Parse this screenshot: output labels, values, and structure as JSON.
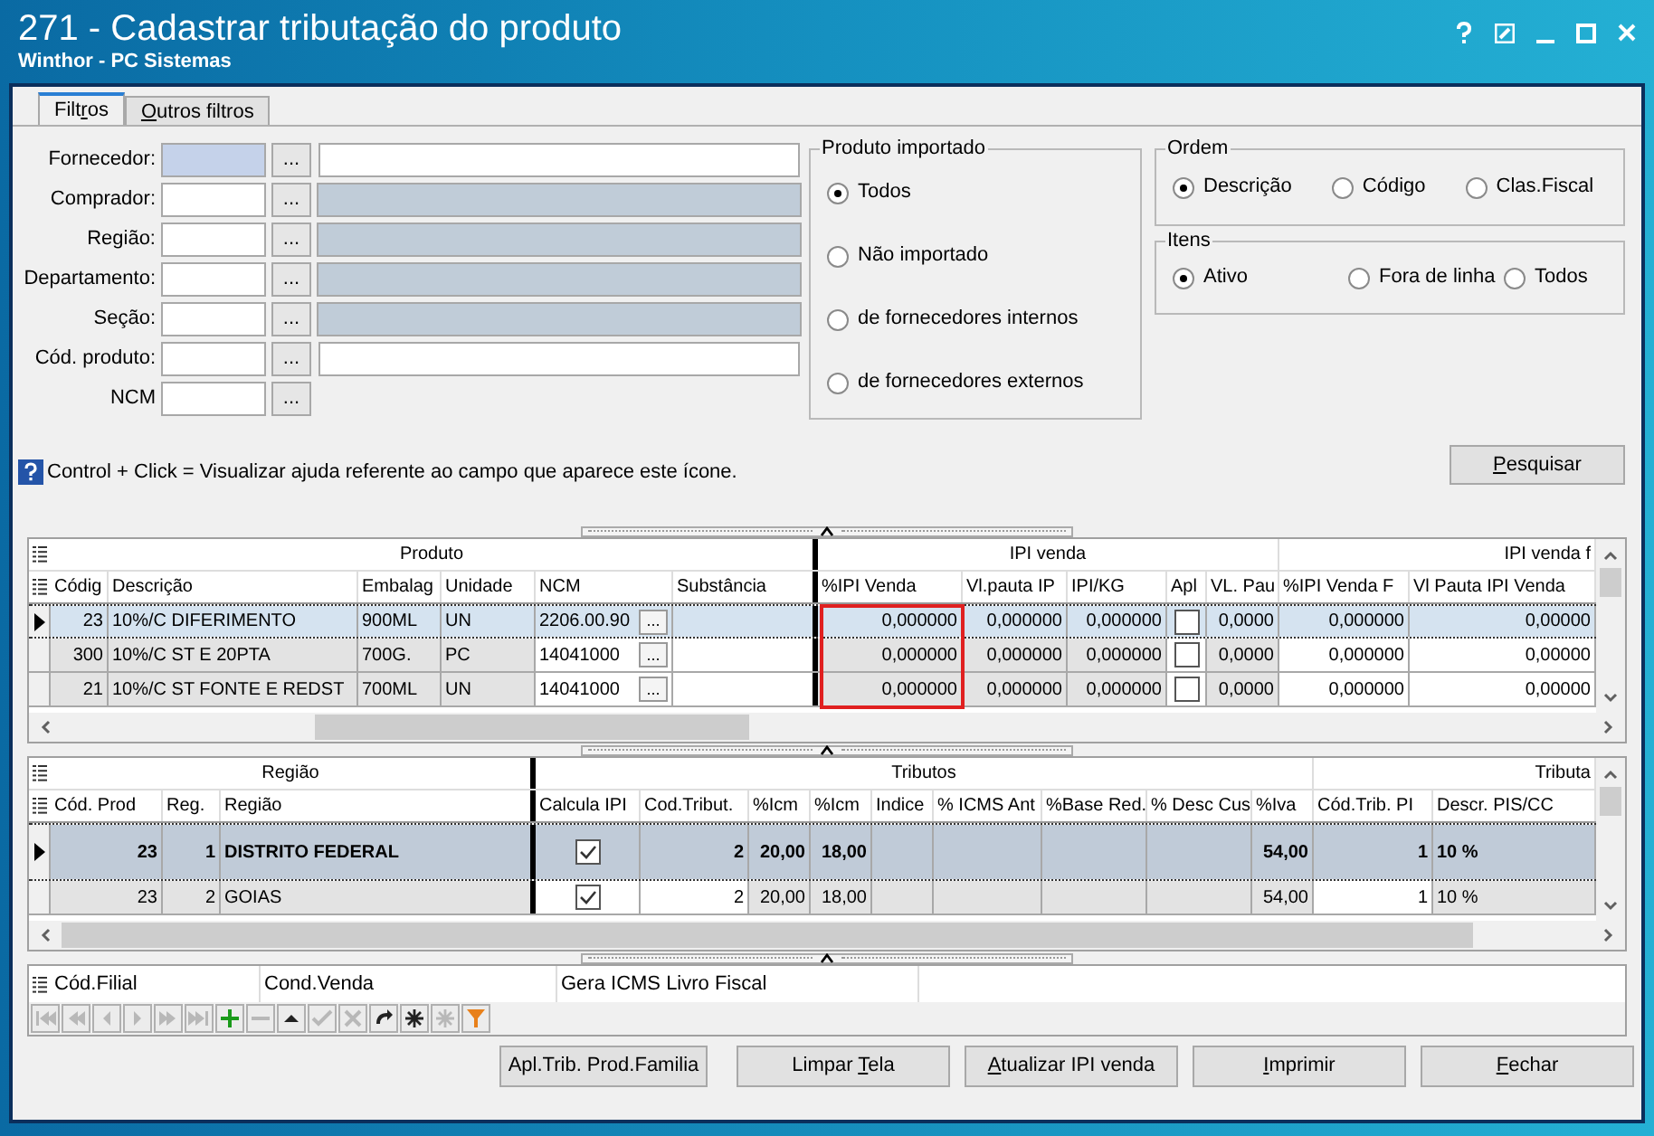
{
  "window": {
    "title": "271 - Cadastrar tributação do produto",
    "subtitle": "Winthor - PC Sistemas"
  },
  "tabs": [
    {
      "label_parts": {
        "before": "Filt",
        "accel": "r",
        "after": "os"
      },
      "selected": true
    },
    {
      "label_parts": {
        "accel": "O",
        "after": "utros filtros"
      },
      "selected": false
    }
  ],
  "filters": [
    {
      "label": "Fornecedor:",
      "focused": true,
      "lookup": "...",
      "description_readonly": false
    },
    {
      "label": "Comprador:",
      "focused": false,
      "lookup": "...",
      "description_readonly": true
    },
    {
      "label": "Região:",
      "focused": false,
      "lookup": "...",
      "description_readonly": true
    },
    {
      "label": "Departamento:",
      "focused": false,
      "lookup": "...",
      "description_readonly": true
    },
    {
      "label": "Seção:",
      "focused": false,
      "lookup": "...",
      "description_readonly": true
    },
    {
      "label": "Cód. produto:",
      "focused": false,
      "lookup": "...",
      "description_readonly": false
    },
    {
      "label": "NCM",
      "focused": false,
      "lookup": "..."
    }
  ],
  "help_text": "Control + Click = Visualizar ajuda referente ao campo que aparece este ícone.",
  "produto_importado": {
    "title": "Produto importado",
    "options": [
      {
        "label": "Todos",
        "selected": true
      },
      {
        "label": "Não importado",
        "selected": false
      },
      {
        "label": "de fornecedores internos",
        "selected": false
      },
      {
        "label": "de fornecedores externos",
        "selected": false
      }
    ]
  },
  "ordem": {
    "title": "Ordem",
    "options": [
      {
        "label": "Descrição",
        "selected": true
      },
      {
        "label": "Código",
        "selected": false
      },
      {
        "label": "Clas.Fiscal",
        "selected": false
      }
    ]
  },
  "itens": {
    "title": "Itens",
    "options": [
      {
        "label": "Ativo",
        "selected": true
      },
      {
        "label": "Fora de linha",
        "selected": false
      },
      {
        "label": "Todos",
        "selected": false
      }
    ]
  },
  "search_button": {
    "label_parts": {
      "accel": "P",
      "after": "esquisar"
    }
  },
  "product_grid": {
    "groups": [
      {
        "label": "Produto"
      },
      {
        "label": "IPI venda"
      },
      {
        "label": "IPI venda f"
      }
    ],
    "columns": [
      {
        "label": "Códig",
        "kind": "number",
        "readonly": true,
        "highlighted": false
      },
      {
        "label": "Descrição",
        "kind": "text",
        "readonly": true,
        "highlighted": false
      },
      {
        "label": "Embalag",
        "kind": "text",
        "readonly": true,
        "highlighted": false
      },
      {
        "label": "Unidade",
        "kind": "text",
        "readonly": true,
        "highlighted": false
      },
      {
        "label": "NCM",
        "kind": "lookup",
        "readonly": false,
        "highlighted": false
      },
      {
        "label": "Substância",
        "kind": "text",
        "readonly": false,
        "highlighted": false
      },
      {
        "label": "%IPI Venda",
        "kind": "number",
        "readonly": true,
        "highlighted": true
      },
      {
        "label": "Vl.pauta IP",
        "kind": "number",
        "readonly": true,
        "highlighted": false
      },
      {
        "label": "IPI/KG",
        "kind": "number",
        "readonly": true,
        "highlighted": false
      },
      {
        "label": "Apl",
        "kind": "check",
        "readonly": false,
        "highlighted": false
      },
      {
        "label": "VL. Pau",
        "kind": "number",
        "readonly": true,
        "highlighted": false
      },
      {
        "label": "%IPI Venda F",
        "kind": "number",
        "readonly": false,
        "highlighted": false
      },
      {
        "label": "Vl Pauta IPI Venda",
        "kind": "number",
        "readonly": false,
        "highlighted": false
      }
    ],
    "rows": [
      {
        "selected": true,
        "cells": [
          "23",
          "10%/C DIFERIMENTO",
          "900ML",
          "UN",
          "2206.00.90",
          null,
          "0,000000",
          "0,000000",
          "0,000000",
          {
            "checked": false
          },
          "0,0000",
          "0,000000",
          "0,00000"
        ]
      },
      {
        "selected": false,
        "cells": [
          "300",
          "10%/C ST E 20PTA",
          "700G.",
          "PC",
          "14041000",
          null,
          "0,000000",
          "0,000000",
          "0,000000",
          {
            "checked": false
          },
          "0,0000",
          "0,000000",
          "0,00000"
        ]
      },
      {
        "selected": false,
        "cells": [
          "21",
          "10%/C ST FONTE E REDST",
          "700ML",
          "UN",
          "14041000",
          null,
          "0,000000",
          "0,000000",
          "0,000000",
          {
            "checked": false
          },
          "0,0000",
          "0,000000",
          "0,00000"
        ]
      }
    ],
    "lookup_button": "..."
  },
  "region_grid": {
    "groups": [
      {
        "label": "Região"
      },
      {
        "label": "Tributos"
      },
      {
        "label": "Tributa"
      }
    ],
    "columns": [
      {
        "label": "Cód. Prod",
        "kind": "number",
        "readonly": true
      },
      {
        "label": "Reg.",
        "kind": "number",
        "readonly": true
      },
      {
        "label": "Região",
        "kind": "text",
        "readonly": true
      },
      {
        "label": "Calcula IPI",
        "kind": "check",
        "readonly": false
      },
      {
        "label": "Cod.Tribut.",
        "kind": "number",
        "readonly": false
      },
      {
        "label": "%Icm",
        "kind": "number",
        "readonly": true
      },
      {
        "label": "%Icm",
        "kind": "number",
        "readonly": true
      },
      {
        "label": "Indice",
        "kind": "number",
        "readonly": true
      },
      {
        "label": "% ICMS Ant",
        "kind": "number",
        "readonly": true
      },
      {
        "label": "%Base Red.",
        "kind": "number",
        "readonly": true
      },
      {
        "label": "% Desc Cus",
        "kind": "number",
        "readonly": true
      },
      {
        "label": "%Iva",
        "kind": "number",
        "readonly": true
      },
      {
        "label": "Cód.Trib. PI",
        "kind": "number",
        "readonly": false
      },
      {
        "label": "Descr. PIS/CC",
        "kind": "text",
        "readonly": true
      }
    ],
    "rows": [
      {
        "selected": true,
        "cells": [
          "23",
          "1",
          "DISTRITO FEDERAL",
          {
            "checked": true
          },
          "2",
          "20,00",
          "18,00",
          null,
          null,
          null,
          null,
          "54,00",
          "1",
          "10 %"
        ]
      },
      {
        "selected": false,
        "cells": [
          "23",
          "2",
          "GOIAS",
          {
            "checked": true
          },
          "2",
          "20,00",
          "18,00",
          null,
          null,
          null,
          null,
          "54,00",
          "1",
          "10 %"
        ]
      }
    ]
  },
  "filial_grid": {
    "columns": [
      "Cód.Filial",
      "Cond.Venda",
      "Gera ICMS Livro Fiscal"
    ]
  },
  "navigator": [
    {
      "kind": "first",
      "disabled": true
    },
    {
      "kind": "prior-page",
      "disabled": true
    },
    {
      "kind": "prior",
      "disabled": true
    },
    {
      "kind": "next",
      "disabled": true
    },
    {
      "kind": "next-page",
      "disabled": true
    },
    {
      "kind": "last",
      "disabled": true
    },
    {
      "kind": "insert",
      "disabled": false
    },
    {
      "kind": "delete",
      "disabled": true
    },
    {
      "kind": "edit",
      "disabled": false
    },
    {
      "kind": "post",
      "disabled": true
    },
    {
      "kind": "cancel",
      "disabled": true
    },
    {
      "kind": "refresh",
      "disabled": false
    },
    {
      "kind": "asterisk",
      "disabled": false
    },
    {
      "kind": "asterisk",
      "disabled": true
    },
    {
      "kind": "filter",
      "disabled": false
    }
  ],
  "buttons": [
    {
      "label_parts": {
        "before": "Apl.Trib. Prod.Familia"
      }
    },
    {
      "label_parts": {
        "before": "Limpar ",
        "accel": "T",
        "after": "ela"
      }
    },
    {
      "label_parts": {
        "accel": "A",
        "after": "tualizar IPI venda"
      }
    },
    {
      "label_parts": {
        "accel": "I",
        "after": "mprimir"
      }
    },
    {
      "label_parts": {
        "accel": "F",
        "after": "echar"
      }
    }
  ]
}
